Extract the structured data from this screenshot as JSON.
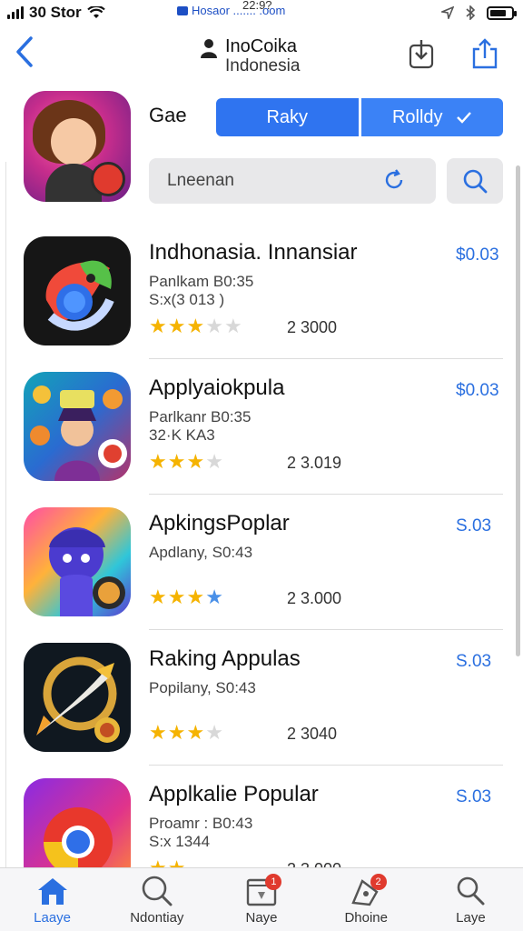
{
  "status_bar": {
    "carrier": "30 Stor",
    "center_text": "Hosaor ....... .oom",
    "time": "22:9?"
  },
  "nav": {
    "title_line1": "InoCoika",
    "title_line2": "Indonesia"
  },
  "header": {
    "section_label": "Gae",
    "segments": [
      "Raky",
      "Rolldy"
    ]
  },
  "search": {
    "placeholder": "Lneenan"
  },
  "apps": [
    {
      "name": "Indhonasia. Innansiar",
      "sub1": "Panlkam   B0:35",
      "sub2": "S:x(3 013 )",
      "stars": [
        1,
        1,
        0.5,
        0,
        0
      ],
      "count": "2 3000",
      "price": "$0.03"
    },
    {
      "name": "Applyaiokpula",
      "sub1": "Parlkanr   B0:35",
      "sub2": "32·K KA3",
      "stars": [
        1,
        1,
        0.5,
        0,
        0
      ],
      "count": "2 3.019",
      "price": "$0.03"
    },
    {
      "name": "ApkingsPoplar",
      "sub1": "Apdlany, S0:43",
      "sub2": "",
      "stars": [
        1,
        1,
        0.5,
        2,
        0
      ],
      "count": "2 3.000",
      "price": "S.03"
    },
    {
      "name": "Raking Appulas",
      "sub1": "Popilany, S0:43",
      "sub2": "",
      "stars": [
        1,
        1,
        1,
        0,
        0
      ],
      "count": "2 3040",
      "price": "S.03"
    },
    {
      "name": "Applkalie Popular",
      "sub1": "Proamr :   B0:43",
      "sub2": "S:x 1344",
      "stars": [
        1,
        1,
        0,
        0,
        0
      ],
      "count": "2 3.000",
      "price": "S.03"
    }
  ],
  "tabbar": [
    {
      "label": "Laaye",
      "icon": "home-icon",
      "active": true
    },
    {
      "label": "Ndontiay",
      "icon": "search-icon",
      "active": false
    },
    {
      "label": "Naye",
      "icon": "news-icon",
      "badge": "1",
      "active": false
    },
    {
      "label": "Dhoine",
      "icon": "games-icon",
      "badge": "2",
      "active": false
    },
    {
      "label": "Laye",
      "icon": "profile-icon",
      "active": false
    }
  ]
}
